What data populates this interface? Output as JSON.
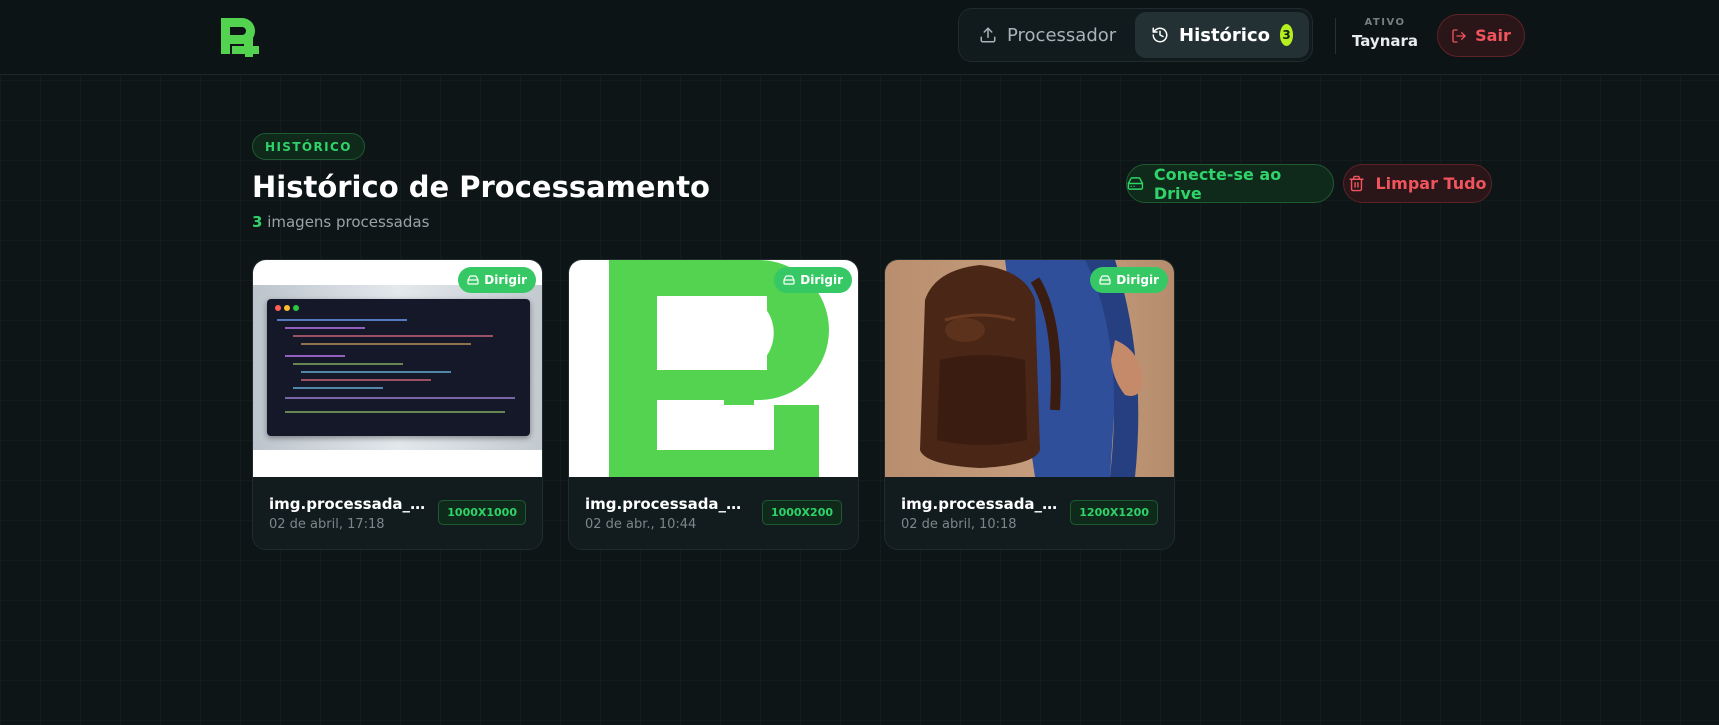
{
  "brand": {
    "accent": "#53d350",
    "danger": "#f0545c",
    "success": "#2fd36a"
  },
  "nav": {
    "processor_label": "Processador",
    "processor_icon": "upload-icon",
    "history_label": "Histórico",
    "history_icon": "history-icon",
    "history_count": "3"
  },
  "user": {
    "status_label": "ATIVO",
    "name": "Taynara",
    "logout_label": "Sair",
    "logout_icon": "logout-icon"
  },
  "page": {
    "tag": "HISTÓRICO",
    "title": "Histórico de Processamento",
    "count": "3",
    "count_suffix": " imagens processadas",
    "drive_button": "Conecte-se ao Drive",
    "clear_button": "Limpar Tudo"
  },
  "cards": [
    {
      "name": "img.processada_IMG_code_screenshot.png",
      "date": "02 de abril, 17:18",
      "resolution": "1000X1000",
      "drive_label": "Dirigir",
      "thumb": "code-screenshot"
    },
    {
      "name": "img.processada_imagem_logo.png",
      "date": "02 de abr., 10:44",
      "resolution": "1000X200",
      "drive_label": "Dirigir",
      "thumb": "green-logo"
    },
    {
      "name": "img.processada_Danfe_mochila.png",
      "date": "02 de abril, 10:18",
      "resolution": "1200X1200",
      "drive_label": "Dirigir",
      "thumb": "leather-backpack"
    }
  ]
}
